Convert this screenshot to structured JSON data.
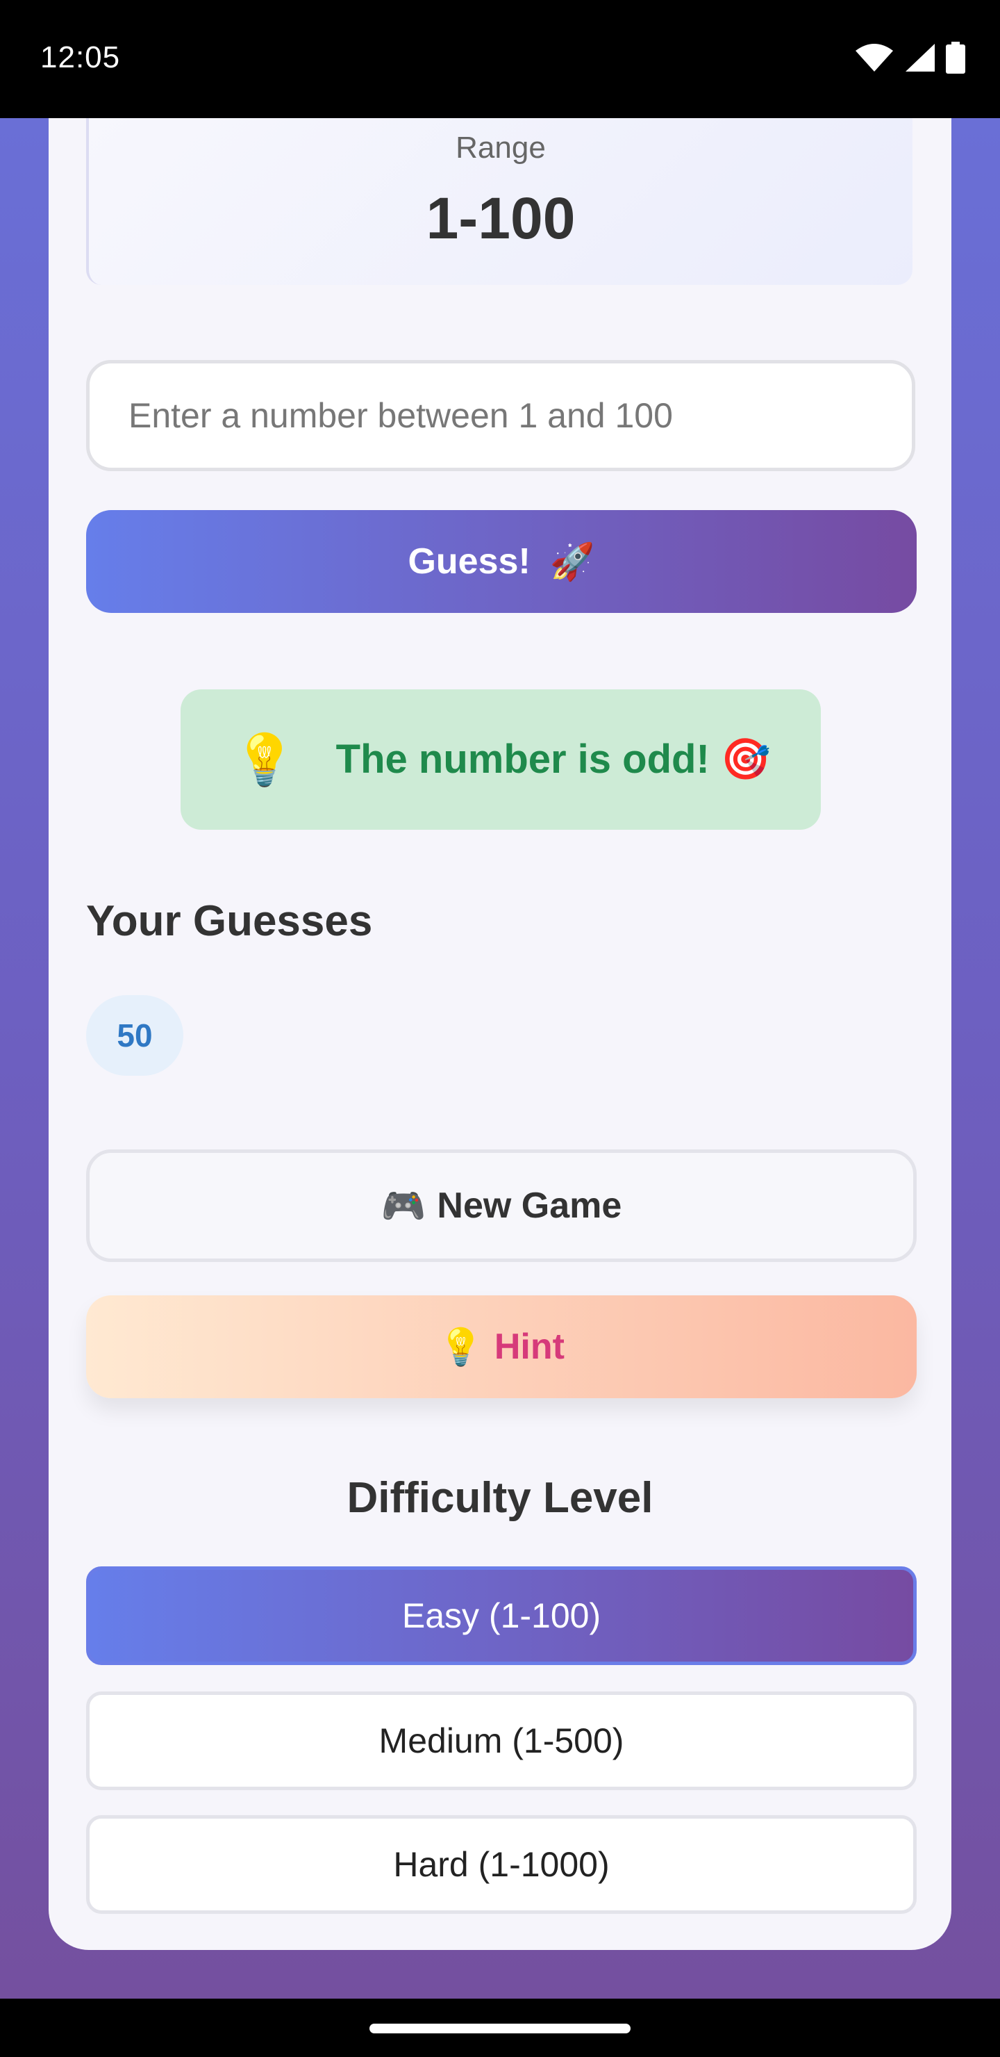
{
  "status_bar": {
    "time": "12:05",
    "icons": [
      "wifi-icon",
      "signal-icon",
      "battery-icon"
    ]
  },
  "range": {
    "label": "Range",
    "value": "1-100"
  },
  "input": {
    "placeholder": "Enter a number between 1 and 100"
  },
  "guess_button": {
    "label": "Guess!",
    "emoji": "🚀"
  },
  "feedback": {
    "icon": "💡",
    "text": "The number is odd! 🎯"
  },
  "guesses": {
    "title": "Your Guesses",
    "items": [
      "50"
    ]
  },
  "actions": {
    "new_game": {
      "emoji": "🎮",
      "label": "New Game"
    },
    "hint": {
      "emoji": "💡",
      "label": "Hint"
    }
  },
  "difficulty": {
    "title": "Difficulty Level",
    "levels": [
      {
        "label": "Easy (1-100)",
        "selected": true
      },
      {
        "label": "Medium (1-500)",
        "selected": false
      },
      {
        "label": "Hard (1-1000)",
        "selected": false
      }
    ]
  },
  "colors": {
    "primary_gradient_start": "#667eea",
    "primary_gradient_end": "#764ba2",
    "feedback_bg": "#cdebd6",
    "feedback_text": "#1f8a4c",
    "hint_text": "#d63a7a",
    "chip_bg": "#e6f0fb",
    "chip_text": "#2f78c4"
  }
}
